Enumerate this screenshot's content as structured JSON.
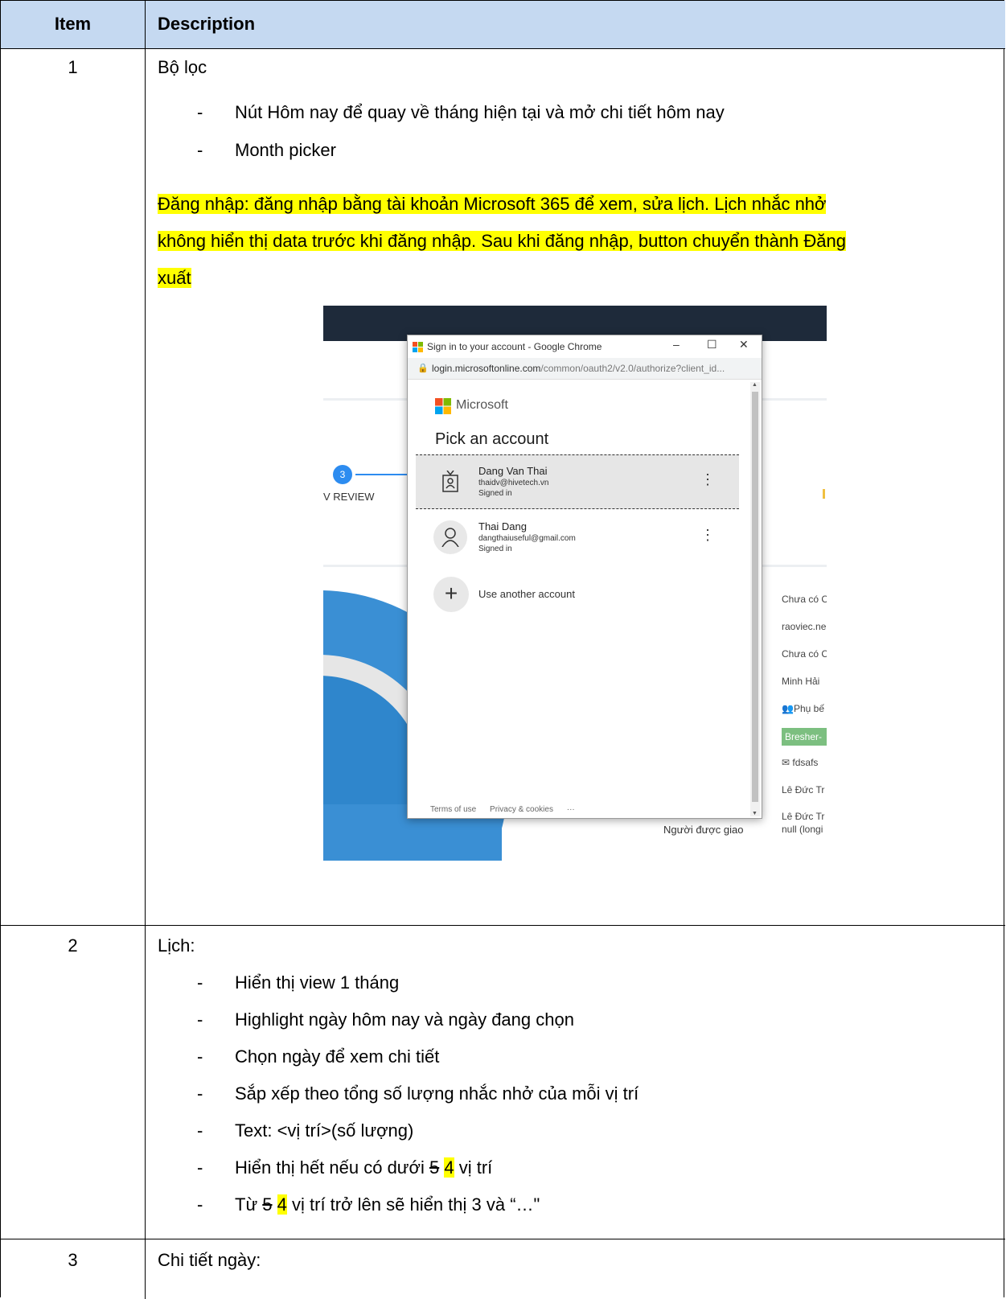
{
  "table": {
    "headers": {
      "item": "Item",
      "description": "Description"
    },
    "rows": [
      {
        "number": "1",
        "title": "Bộ lọc",
        "bullets": [
          "Nút Hôm nay để quay về tháng hiện tại và mở chi tiết hôm nay",
          "Month picker"
        ],
        "highlight_lines": [
          "Đăng nhập: đăng nhập bằng tài khoản Microsoft 365 để xem, sửa lịch. Lịch nhắc nhở",
          "không hiển thị data trước khi đăng nhập. Sau khi đăng nhập, button chuyển thành Đăng",
          "xuất"
        ]
      },
      {
        "number": "2",
        "title": "Lịch:",
        "bullets": [
          "Hiển thị view 1 tháng",
          "Highlight ngày hôm nay và ngày đang chọn",
          "Chọn ngày để xem chi tiết",
          "Sắp xếp theo tổng số lượng nhắc nhở của mỗi vị trí",
          "Text: <vị trí>(số lượng)"
        ],
        "bullet6": {
          "before": "Hiển thị hết nếu có dưới ",
          "struck": "5",
          "new": "4",
          "after": " vị trí"
        },
        "bullet7": {
          "before": "Từ ",
          "struck": "5",
          "new": "4",
          "after": " vị trí trở lên sẽ hiển thị 3 và “…\""
        }
      },
      {
        "number": "3",
        "title": "Chi tiết ngày:"
      }
    ],
    "dash": "-"
  },
  "screenshot": {
    "step_number": "3",
    "step_label": "V REVIEW",
    "right_column": [
      "Chưa có C",
      "raoviec.ne",
      "Chưa có C",
      "Minh Hải",
      "Phụ bế",
      "Bresher-",
      "fdsafs",
      "Lê Đức Tr",
      "Lê Đức Tr"
    ],
    "assignee_label": "Người được giao",
    "null_text": "null (longi",
    "popup": {
      "window_title": "Sign in to your account - Google Chrome",
      "url_main": "login.microsoftonline.com",
      "url_rest": "/common/oauth2/v2.0/authorize?client_id...",
      "brand": "Microsoft",
      "heading": "Pick an account",
      "accounts": [
        {
          "name": "Dang Van Thai",
          "email": "thaidv@hivetech.vn",
          "status": "Signed in"
        },
        {
          "name": "Thai Dang",
          "email": "dangthaiuseful@gmail.com",
          "status": "Signed in"
        }
      ],
      "use_another": "Use another account",
      "footer": [
        "Terms of use",
        "Privacy & cookies",
        "···"
      ]
    },
    "colors": {
      "ms_red": "#f25022",
      "ms_green": "#7fba00",
      "ms_blue": "#00a4ef",
      "ms_yellow": "#ffb900"
    }
  }
}
